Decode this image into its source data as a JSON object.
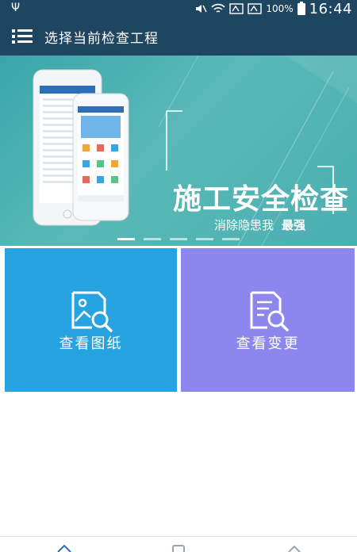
{
  "status_bar": {
    "time": "16:44",
    "battery": "100%"
  },
  "app_bar": {
    "title": "选择当前检查工程"
  },
  "banner": {
    "headline": "施工安全检查",
    "subtitle": "消除隐患我",
    "emphasis": "最强",
    "slide_count": 5,
    "active_slide": 1
  },
  "cards": [
    {
      "label": "查看图纸",
      "color": "#26a3e0",
      "icon": "image-search-icon"
    },
    {
      "label": "查看变更",
      "color": "#8d86ee",
      "icon": "document-search-icon"
    }
  ],
  "colors": {
    "header": "#1f4660",
    "banner_teal": "#4aaeb0"
  }
}
